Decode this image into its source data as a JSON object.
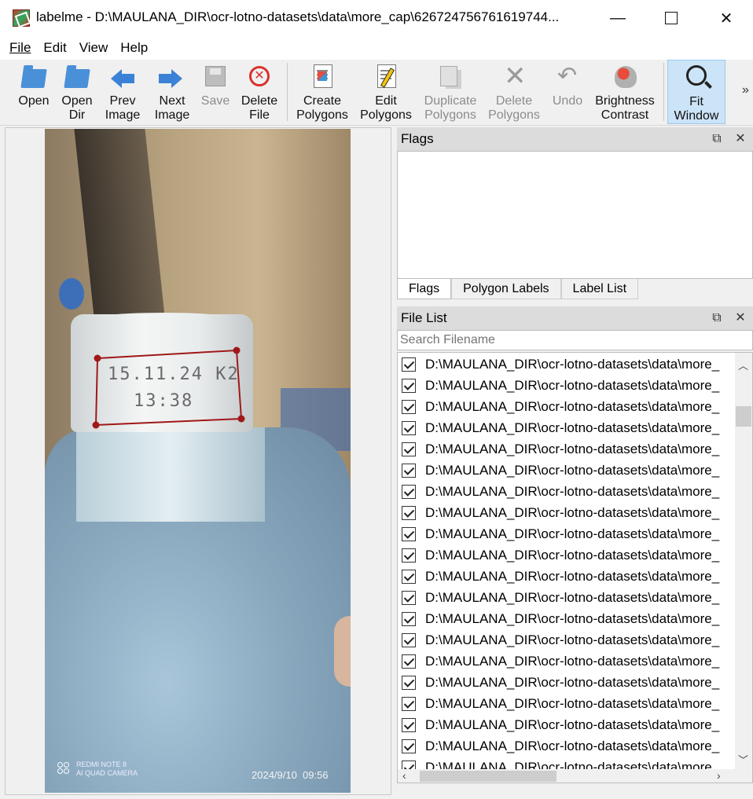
{
  "window": {
    "title": "labelme - D:\\MAULANA_DIR\\ocr-lotno-datasets\\data\\more_cap\\626724756761619744...",
    "minimize": "—",
    "close": "✕"
  },
  "menu": [
    "File",
    "Edit",
    "View",
    "Help"
  ],
  "toolbar": {
    "open": "Open",
    "open_dir": "Open\nDir",
    "prev_image": "Prev\nImage",
    "next_image": "Next\nImage",
    "save": "Save",
    "delete_file": "Delete\nFile",
    "create_polygons": "Create\nPolygons",
    "edit_polygons": "Edit\nPolygons",
    "duplicate_polygons": "Duplicate\nPolygons",
    "delete_polygons": "Delete\nPolygons",
    "undo": "Undo",
    "brightness_contrast": "Brightness\nContrast",
    "fit_window": "Fit\nWindow",
    "more": "»"
  },
  "canvas": {
    "code_line1": "15.11.24 K2",
    "code_line2": "13:38",
    "camera_model": "REDMI NOTE 8",
    "camera_sub": "AI QUAD CAMERA",
    "timestamp": "2024/9/10  09:56"
  },
  "flags_dock": {
    "title": "Flags",
    "tabs": [
      "Flags",
      "Polygon Labels",
      "Label List"
    ],
    "active_tab": "Flags"
  },
  "file_list": {
    "title": "File List",
    "search_placeholder": "Search Filename",
    "items": [
      "D:\\MAULANA_DIR\\ocr-lotno-datasets\\data\\more_",
      "D:\\MAULANA_DIR\\ocr-lotno-datasets\\data\\more_",
      "D:\\MAULANA_DIR\\ocr-lotno-datasets\\data\\more_",
      "D:\\MAULANA_DIR\\ocr-lotno-datasets\\data\\more_",
      "D:\\MAULANA_DIR\\ocr-lotno-datasets\\data\\more_",
      "D:\\MAULANA_DIR\\ocr-lotno-datasets\\data\\more_",
      "D:\\MAULANA_DIR\\ocr-lotno-datasets\\data\\more_",
      "D:\\MAULANA_DIR\\ocr-lotno-datasets\\data\\more_",
      "D:\\MAULANA_DIR\\ocr-lotno-datasets\\data\\more_",
      "D:\\MAULANA_DIR\\ocr-lotno-datasets\\data\\more_",
      "D:\\MAULANA_DIR\\ocr-lotno-datasets\\data\\more_",
      "D:\\MAULANA_DIR\\ocr-lotno-datasets\\data\\more_",
      "D:\\MAULANA_DIR\\ocr-lotno-datasets\\data\\more_",
      "D:\\MAULANA_DIR\\ocr-lotno-datasets\\data\\more_",
      "D:\\MAULANA_DIR\\ocr-lotno-datasets\\data\\more_",
      "D:\\MAULANA_DIR\\ocr-lotno-datasets\\data\\more_",
      "D:\\MAULANA_DIR\\ocr-lotno-datasets\\data\\more_",
      "D:\\MAULANA_DIR\\ocr-lotno-datasets\\data\\more_",
      "D:\\MAULANA_DIR\\ocr-lotno-datasets\\data\\more_",
      "D:\\MAULANA_DIR\\ocr-lotno-datasets\\data\\more"
    ]
  },
  "colors": {
    "polygon": "#a01818",
    "active_tool": "#cce4f7",
    "dock_title": "#dcdcdc"
  }
}
